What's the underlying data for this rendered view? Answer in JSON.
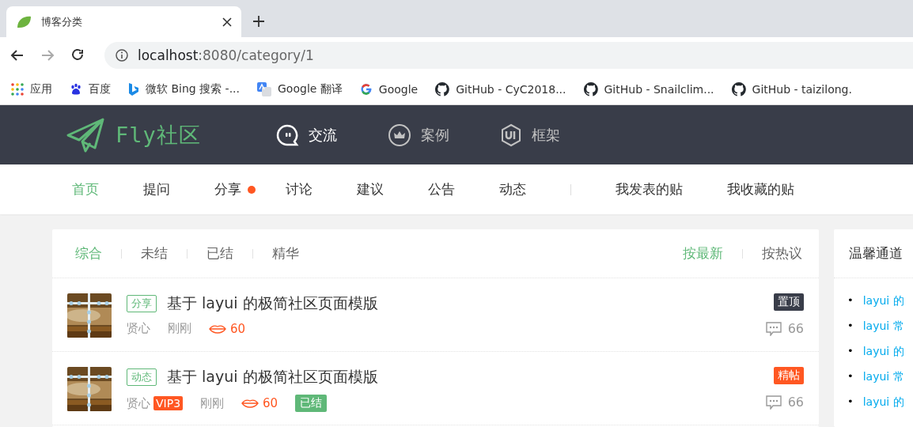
{
  "browser": {
    "tab_title": "博客分类",
    "address": {
      "host": "localhost",
      "path": ":8080/category/1"
    },
    "bookmarks": [
      {
        "kind": "apps",
        "label": "应用"
      },
      {
        "kind": "paw",
        "label": "百度"
      },
      {
        "kind": "bing",
        "label": "微软 Bing 搜索 -..."
      },
      {
        "kind": "translate",
        "label": "Google 翻译"
      },
      {
        "kind": "google",
        "label": "Google"
      },
      {
        "kind": "github",
        "label": "GitHub - CyC2018..."
      },
      {
        "kind": "github",
        "label": "GitHub - Snailclim..."
      },
      {
        "kind": "github",
        "label": "GitHub - taizilong."
      }
    ]
  },
  "header": {
    "logo": "Fly社区",
    "nav": [
      {
        "kind": "chat",
        "label": "交流",
        "selected": true
      },
      {
        "kind": "crown",
        "label": "案例",
        "selected": false
      },
      {
        "kind": "ui",
        "label": "框架",
        "selected": false
      }
    ]
  },
  "subnav": {
    "items": [
      {
        "label": "首页",
        "selected": true,
        "dot": false
      },
      {
        "label": "提问",
        "selected": false,
        "dot": false
      },
      {
        "label": "分享",
        "selected": false,
        "dot": true
      },
      {
        "label": "讨论",
        "selected": false,
        "dot": false
      },
      {
        "label": "建议",
        "selected": false,
        "dot": false
      },
      {
        "label": "公告",
        "selected": false,
        "dot": false
      },
      {
        "label": "动态",
        "selected": false,
        "dot": false
      }
    ],
    "user_links": [
      "我发表的贴",
      "我收藏的贴"
    ]
  },
  "filters": [
    {
      "label": "综合",
      "selected": true
    },
    {
      "label": "未结",
      "selected": false
    },
    {
      "label": "已结",
      "selected": false
    },
    {
      "label": "精华",
      "selected": false
    }
  ],
  "sort": [
    {
      "label": "按最新",
      "selected": true
    },
    {
      "label": "按热议",
      "selected": false
    }
  ],
  "posts": [
    {
      "tag": "分享",
      "title": "基于 layui 的极简社区页面模版",
      "author": "贤心",
      "time": "刚刚",
      "views": "60",
      "badge": {
        "kind": "top",
        "label": "置顶"
      },
      "comments": "66"
    },
    {
      "tag": "动态",
      "title": "基于 layui 的极简社区页面模版",
      "author": "贤心",
      "vip": "VIP3",
      "time": "刚刚",
      "views": "60",
      "status": "已结",
      "badge": {
        "kind": "featured",
        "label": "精帖"
      },
      "comments": "66"
    }
  ],
  "sidebar": {
    "title": "温馨通道",
    "bullet": "•",
    "links": [
      "layui 的",
      "layui 常",
      "layui 的",
      "layui 常",
      "layui 的"
    ]
  }
}
